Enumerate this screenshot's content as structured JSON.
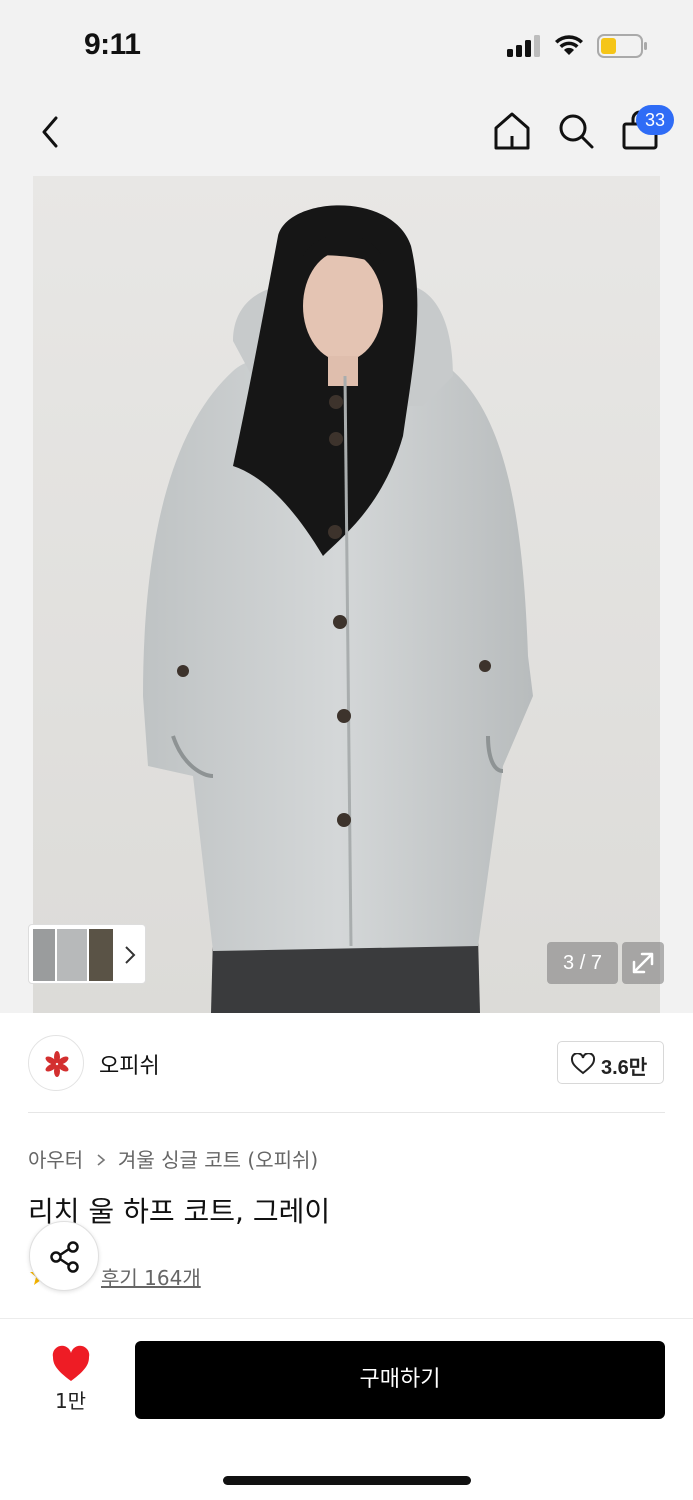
{
  "status_bar": {
    "time": "9:11"
  },
  "nav": {
    "back_icon": "chevron-left-icon",
    "home_icon": "home-icon",
    "search_icon": "search-icon",
    "cart_icon": "shopping-bag-icon",
    "cart_badge": "33",
    "badge_color": "#2f6cf6"
  },
  "gallery": {
    "counter": "3 / 7",
    "expand_icon": "expand-icon"
  },
  "brand": {
    "name": "오피쉬",
    "like_count": "3.6만",
    "logo_color": "#d32f2f"
  },
  "product": {
    "breadcrumb": [
      "아우터",
      "겨울 싱글 코트 (오피쉬)"
    ],
    "title": "리치 울 하프 코트, 그레이",
    "review_label": "후기 164개"
  },
  "bottom_bar": {
    "wish_count": "1만",
    "wish_color": "#ee1c25",
    "buy_label": "구매하기"
  }
}
